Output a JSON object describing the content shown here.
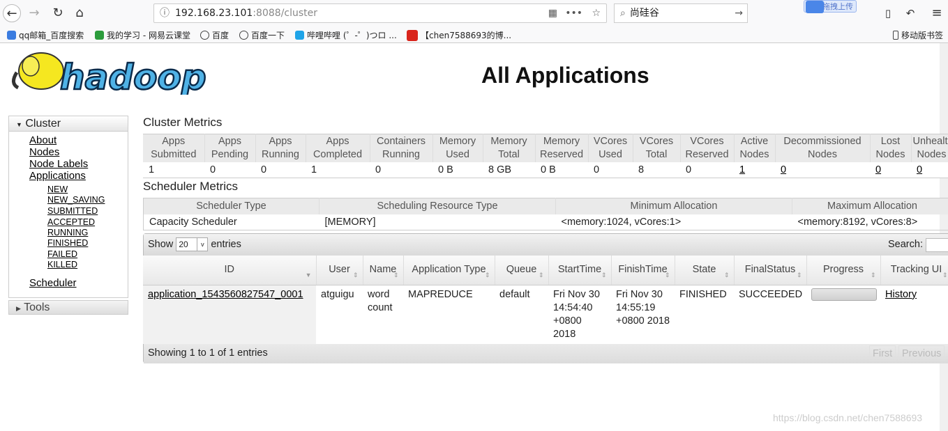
{
  "browser": {
    "url_host": "192.168.23.101",
    "url_rest": ":8088/cluster",
    "search_value": "尚硅谷",
    "upload_label": "拖拽上传",
    "bookmarks": [
      "qq邮箱_百度搜索",
      "我的学习 - 网易云课堂",
      "百度",
      "百度一下",
      "哔哩哔哩 (゜-゜)つロ ...",
      "【chen7588693的博...",
      "移动版书签"
    ]
  },
  "logo": {
    "text": "hadoop"
  },
  "page_title": "All Applications",
  "sidebar": {
    "cluster_label": "Cluster",
    "links": [
      "About",
      "Nodes",
      "Node Labels",
      "Applications"
    ],
    "app_states": [
      "NEW",
      "NEW_SAVING",
      "SUBMITTED",
      "ACCEPTED",
      "RUNNING",
      "FINISHED",
      "FAILED",
      "KILLED"
    ],
    "scheduler": "Scheduler",
    "tools_label": "Tools"
  },
  "cluster_metrics": {
    "title": "Cluster Metrics",
    "headers": [
      [
        "Apps",
        "Submitted"
      ],
      [
        "Apps",
        "Pending"
      ],
      [
        "Apps",
        "Running"
      ],
      [
        "Apps",
        "Completed"
      ],
      [
        "Containers",
        "Running"
      ],
      [
        "Memory",
        "Used"
      ],
      [
        "Memory",
        "Total"
      ],
      [
        "Memory",
        "Reserved"
      ],
      [
        "VCores",
        "Used"
      ],
      [
        "VCores",
        "Total"
      ],
      [
        "VCores",
        "Reserved"
      ],
      [
        "Active",
        "Nodes"
      ],
      [
        "Decommissioned",
        "Nodes"
      ],
      [
        "Lost",
        "Nodes"
      ],
      [
        "Unhealthy",
        "Nodes"
      ]
    ],
    "values": [
      "1",
      "0",
      "0",
      "1",
      "0",
      "0 B",
      "8 GB",
      "0 B",
      "0",
      "8",
      "0",
      "1",
      "0",
      "0",
      "0"
    ]
  },
  "scheduler_metrics": {
    "title": "Scheduler Metrics",
    "headers": [
      "Scheduler Type",
      "Scheduling Resource Type",
      "Minimum Allocation",
      "Maximum Allocation"
    ],
    "values": [
      "Capacity Scheduler",
      "[MEMORY]",
      "<memory:1024, vCores:1>",
      "<memory:8192, vCores:8>"
    ]
  },
  "apps": {
    "show_label": "Show",
    "entries_value": "20",
    "entries_label": "entries",
    "search_label": "Search:",
    "headers": [
      "ID",
      "User",
      "Name",
      "Application Type",
      "Queue",
      "StartTime",
      "FinishTime",
      "State",
      "FinalStatus",
      "Progress",
      "Tracking UI"
    ],
    "rows": [
      {
        "id": "application_1543560827547_0001",
        "user": "atguigu",
        "name": "word count",
        "type": "MAPREDUCE",
        "queue": "default",
        "start": "Fri Nov 30 14:54:40 +0800 2018",
        "finish": "Fri Nov 30 14:55:19 +0800 2018",
        "state": "FINISHED",
        "final": "SUCCEEDED",
        "progress": 100,
        "tracking": "History"
      }
    ],
    "footer": "Showing 1 to 1 of 1 entries",
    "first": "First",
    "previous": "Previous"
  },
  "watermark": "https://blog.csdn.net/chen7588693"
}
